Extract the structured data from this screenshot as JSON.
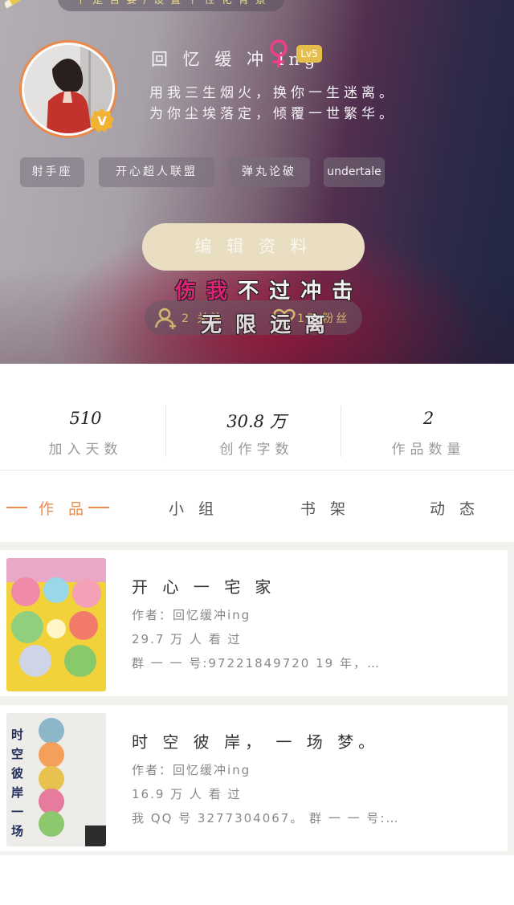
{
  "header": {
    "top_banner": "个 是 否 要 / 设 置 个 性 化 背 景",
    "username": "回 忆 缓 冲 ing",
    "level": "Lv5",
    "bio_line1": "用我三生烟火，换你一生迷离。",
    "bio_line2": "为你尘埃落定，倾覆一世繁华。",
    "tags": [
      "射手座",
      "开心超人联盟",
      "弹丸论破",
      "undertale"
    ],
    "edit_button": "编 辑 资 料",
    "follow_label": "2 关注",
    "fans_label": "17 粉丝",
    "overlay_line1_pink": "伤 我",
    "overlay_line1_rest": "不 过 冲 击",
    "overlay_line2": "无 限 远 离",
    "accent_color": "#ef8b4e"
  },
  "stats": [
    {
      "value": "510",
      "label": "加入天数"
    },
    {
      "value": "30.8 万",
      "label": "创作字数"
    },
    {
      "value": "2",
      "label": "作品数量"
    }
  ],
  "tabs": [
    "作 品",
    "小 组",
    "书 架",
    "动 态"
  ],
  "works": [
    {
      "title": "开 心 一 宅 家",
      "author": "作者：回忆缓冲ing",
      "readers": "29.7 万 人 看 过",
      "intro": "群 一 一 号:97221849720 19 年，…"
    },
    {
      "title": "时 空 彼 岸， 一 场 梦。",
      "author": "作者：回忆缓冲ing",
      "readers": "16.9 万 人 看 过",
      "intro": "我 QQ 号 3277304067。 群 一 一 号:…",
      "cover_text": "时空彼岸一场梦"
    }
  ]
}
